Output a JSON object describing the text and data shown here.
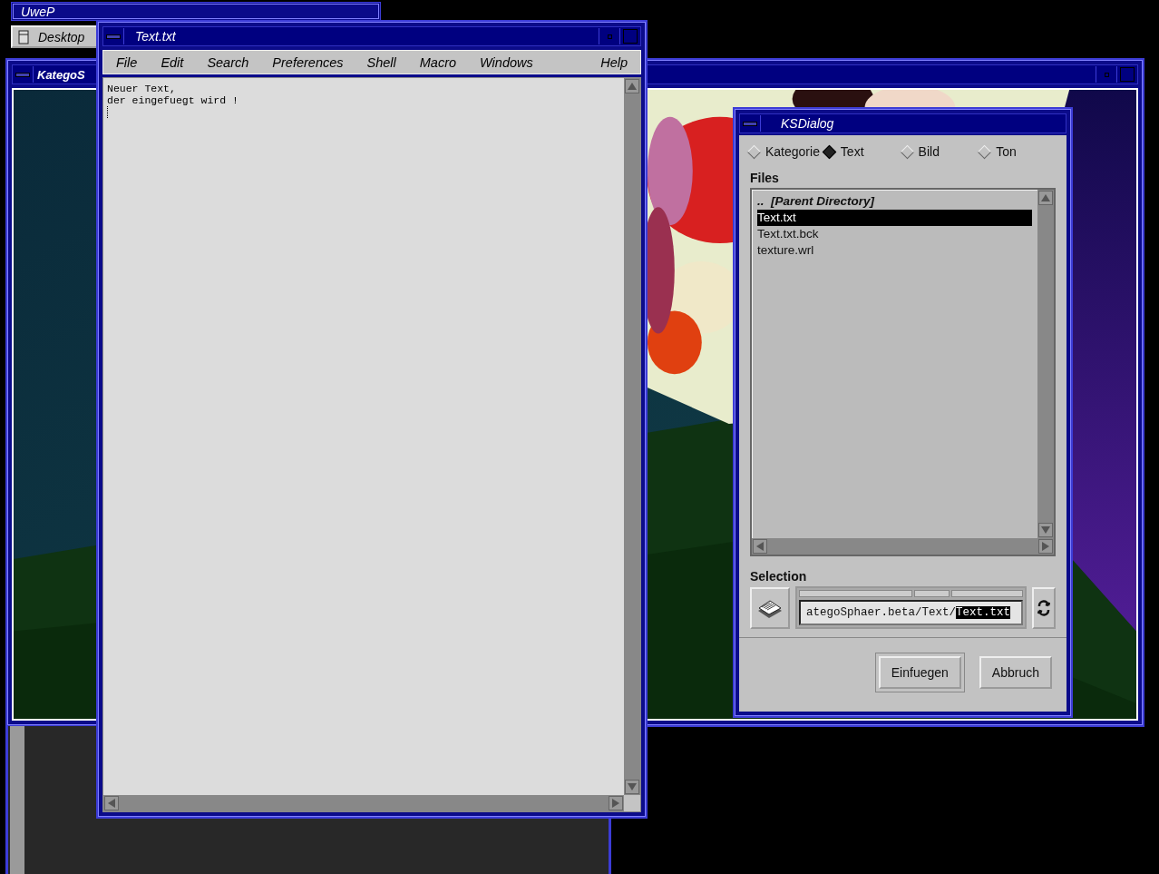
{
  "panel_window": {
    "title": "UweP"
  },
  "desktop_button": {
    "label": "Desktop"
  },
  "scene_window": {
    "title": "KategoS"
  },
  "editor": {
    "title": "Text.txt",
    "menu": [
      "File",
      "Edit",
      "Search",
      "Preferences",
      "Shell",
      "Macro",
      "Windows",
      "Help"
    ],
    "lines": [
      "Neuer Text,",
      "der eingefuegt wird !"
    ]
  },
  "dialog": {
    "title": "KSDialog",
    "modes": [
      {
        "label": "Kategorie",
        "selected": false
      },
      {
        "label": "Text",
        "selected": true
      },
      {
        "label": "Bild",
        "selected": false
      },
      {
        "label": "Ton",
        "selected": false
      }
    ],
    "files_label": "Files",
    "files": [
      {
        "name": "..  [Parent Directory]",
        "kind": "parent",
        "selected": false
      },
      {
        "name": "Text.txt",
        "kind": "file",
        "selected": true
      },
      {
        "name": "Text.txt.bck",
        "kind": "file",
        "selected": false
      },
      {
        "name": "texture.wrl",
        "kind": "file",
        "selected": false
      }
    ],
    "selection_label": "Selection",
    "path": {
      "value": "ategoSphaer.beta/Text/",
      "highlighted": "Text.txt"
    },
    "buttons": [
      {
        "label": "Einfuegen",
        "default": true
      },
      {
        "label": "Abbruch",
        "default": false
      }
    ]
  }
}
